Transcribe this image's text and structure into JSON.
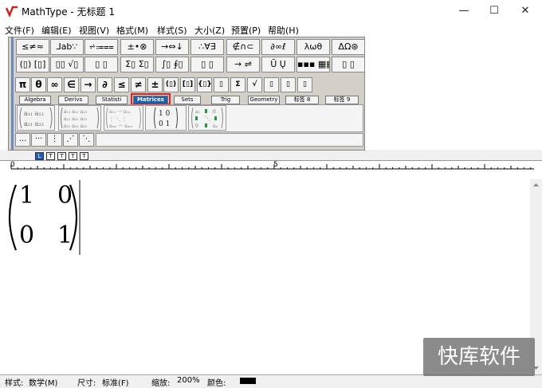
{
  "window": {
    "title": "MathType - 无标题 1",
    "minimize": "—",
    "maximize": "☐",
    "close": "✕"
  },
  "menu": [
    {
      "label": "文件(F)"
    },
    {
      "label": "编辑(E)"
    },
    {
      "label": "视图(V)"
    },
    {
      "label": "格式(M)"
    },
    {
      "label": "样式(S)"
    },
    {
      "label": "大小(Z)"
    },
    {
      "label": "预置(P)"
    },
    {
      "label": "帮助(H)"
    }
  ],
  "palette_row1": [
    "≤≠≈",
    "⅃ab∵",
    "⩫⩴⩵",
    "±•⊗",
    "→⇔↓",
    "∴∀∃",
    "∉∩⊂",
    "∂∞ℓ",
    "λωθ",
    "ΔΩ⊛"
  ],
  "palette_row2": [
    "(▯) [▯]",
    "▯▯ √▯",
    "▯ ▯",
    "Σ▯ Σ▯",
    "∫▯ ∮▯",
    "▯ ▯",
    "→ ⇌",
    "Ū Ų",
    "▪▪▪ ▦▦",
    "▯ ▯"
  ],
  "symbol_row": [
    "π",
    "θ",
    "∞",
    "∈",
    "→",
    "∂",
    "≤",
    "≠",
    "±",
    "(▯)",
    "[▯]",
    "{▯}",
    "▯",
    "Σ",
    "√",
    "▯",
    "▯",
    "▯"
  ],
  "tabs": [
    "Algebra",
    "Derivs",
    "Statisti",
    "Matrices",
    "Sets",
    "Trig",
    "Geometry",
    "标签 8",
    "标签 9"
  ],
  "active_tab": "Matrices",
  "templates": {
    "t1": "a₁₁ a₁₂ / a₂₁ a₂₂",
    "t2": "a₁₁ a₁₂ a₁₃ / a₂₁ a₂₂ a₂₃ / a₃₁ a₃₂ a₃₃",
    "t3": "a₁₁ ··· a₁ₙ / ⋮ ⋱ ⋮ / aₘ₁ ··· aₘₙ",
    "t4_top": "1  0",
    "t4_bottom": "0  1",
    "t5": "a₁ · 0 / · ⋱ · / 0 · aₙ"
  },
  "small_row": [
    "...",
    "···",
    "⋮",
    "⋰",
    "⋱"
  ],
  "tiny_row": [
    "L",
    "T",
    "T",
    "T",
    "T"
  ],
  "ruler": {
    "start": "0",
    "mid": "5"
  },
  "matrix": {
    "r1c1": "1",
    "r1c2": "0",
    "r2c1": "0",
    "r2c2": "1"
  },
  "status": {
    "style_label": "样式:",
    "style_value": "数学(M)",
    "size_label": "尺寸:",
    "size_value": "标准(F)",
    "zoom_label": "缩放:",
    "zoom_value": "200%",
    "color_label": "颜色:"
  },
  "watermark": "快库软件",
  "colors": {
    "accent": "#1a5fb4",
    "highlight": "#e02020",
    "logo": "#d0201b"
  }
}
